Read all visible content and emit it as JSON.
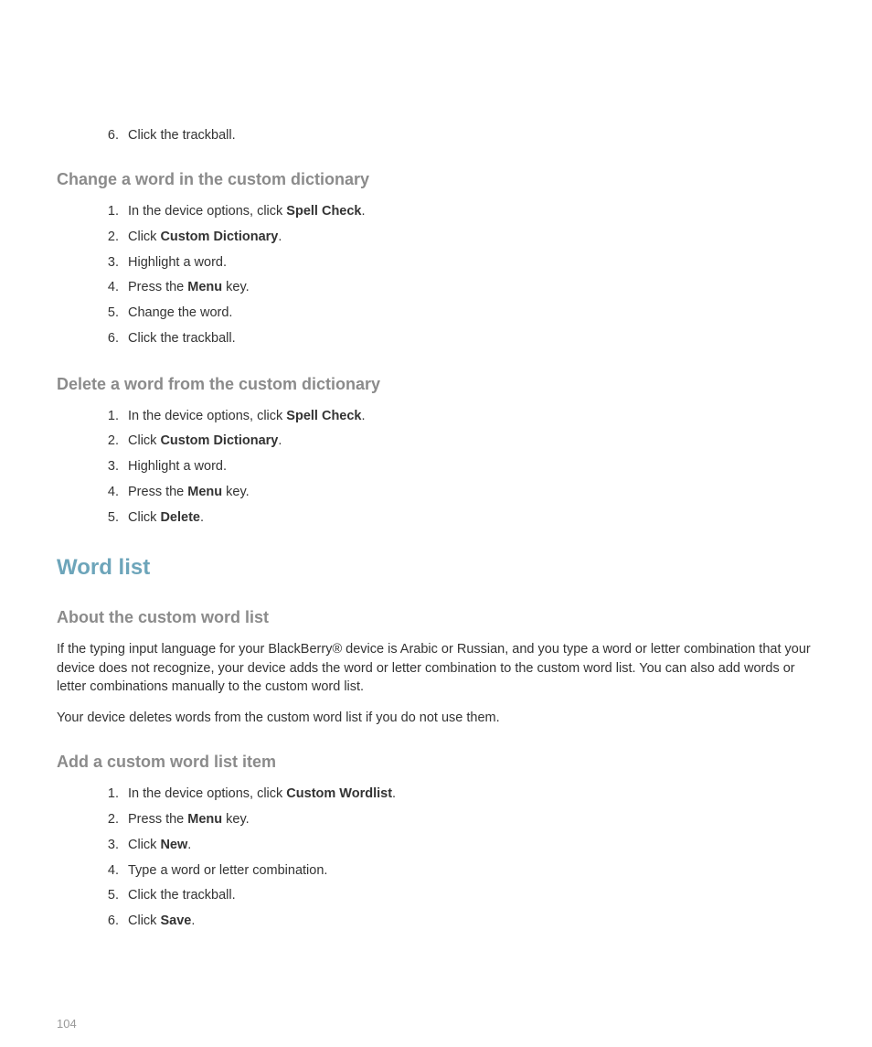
{
  "step_6_prefix": {
    "num": "6.",
    "text": "Click the trackball."
  },
  "section_change": {
    "heading": "Change a word in the custom dictionary",
    "steps": [
      {
        "num": "1.",
        "parts": [
          "In the device options, click ",
          {
            "bold": true,
            "text": "Spell Check"
          },
          "."
        ]
      },
      {
        "num": "2.",
        "parts": [
          "Click ",
          {
            "bold": true,
            "text": "Custom Dictionary"
          },
          "."
        ]
      },
      {
        "num": "3.",
        "parts": [
          "Highlight a word."
        ]
      },
      {
        "num": "4.",
        "parts": [
          "Press the ",
          {
            "bold": true,
            "text": "Menu"
          },
          " key."
        ]
      },
      {
        "num": "5.",
        "parts": [
          "Change the word."
        ]
      },
      {
        "num": "6.",
        "parts": [
          "Click the trackball."
        ]
      }
    ]
  },
  "section_delete": {
    "heading": "Delete a word from the custom dictionary",
    "steps": [
      {
        "num": "1.",
        "parts": [
          "In the device options, click ",
          {
            "bold": true,
            "text": "Spell Check"
          },
          "."
        ]
      },
      {
        "num": "2.",
        "parts": [
          "Click ",
          {
            "bold": true,
            "text": "Custom Dictionary"
          },
          "."
        ]
      },
      {
        "num": "3.",
        "parts": [
          "Highlight a word."
        ]
      },
      {
        "num": "4.",
        "parts": [
          "Press the ",
          {
            "bold": true,
            "text": "Menu"
          },
          " key."
        ]
      },
      {
        "num": "5.",
        "parts": [
          "Click ",
          {
            "bold": true,
            "text": "Delete"
          },
          "."
        ]
      }
    ]
  },
  "main_heading": "Word list",
  "section_about": {
    "heading": "About the custom word list",
    "paragraphs": [
      "If the typing input language for your BlackBerry® device is Arabic or Russian, and you type a word or letter combination that your device does not recognize, your device adds the word or letter combination to the custom word list. You can also add words or letter combinations manually to the custom word list.",
      "Your device deletes words from the custom word list if you do not use them."
    ]
  },
  "section_add": {
    "heading": "Add a custom word list item",
    "steps": [
      {
        "num": "1.",
        "parts": [
          "In the device options, click ",
          {
            "bold": true,
            "text": "Custom Wordlist"
          },
          "."
        ]
      },
      {
        "num": "2.",
        "parts": [
          "Press the ",
          {
            "bold": true,
            "text": "Menu"
          },
          " key."
        ]
      },
      {
        "num": "3.",
        "parts": [
          "Click ",
          {
            "bold": true,
            "text": "New"
          },
          "."
        ]
      },
      {
        "num": "4.",
        "parts": [
          "Type a word or letter combination."
        ]
      },
      {
        "num": "5.",
        "parts": [
          "Click the trackball."
        ]
      },
      {
        "num": "6.",
        "parts": [
          "Click ",
          {
            "bold": true,
            "text": "Save"
          },
          "."
        ]
      }
    ]
  },
  "page_number": "104"
}
